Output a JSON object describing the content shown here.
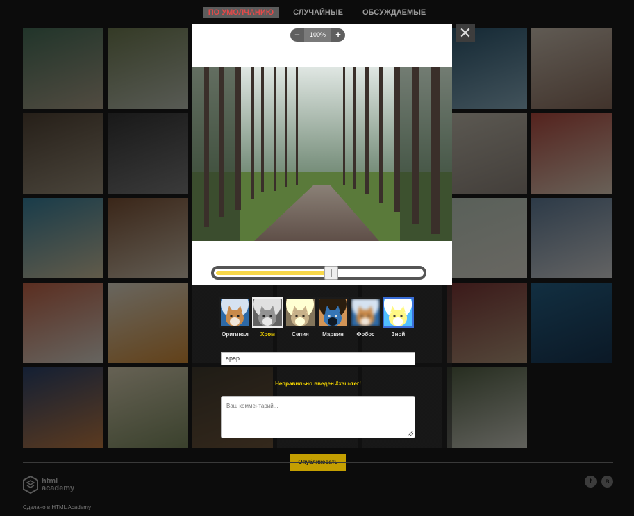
{
  "filters": [
    {
      "label": "По умолчанию",
      "active": true
    },
    {
      "label": "Случайные",
      "active": false
    },
    {
      "label": "Обсуждаемые",
      "active": false
    }
  ],
  "gallery": {
    "thumbs": [
      {
        "name": "thumb-coast-pool",
        "colors": [
          "#3f6d54",
          "#b1a38a"
        ]
      },
      {
        "name": "thumb-sign-field",
        "colors": [
          "#6c7a4a",
          "#c1c7b8"
        ]
      },
      {
        "name": "thumb-hidden-1",
        "colors": [
          "#333",
          "#333"
        ]
      },
      {
        "name": "thumb-hidden-2",
        "colors": [
          "#333",
          "#333"
        ]
      },
      {
        "name": "thumb-hidden-3",
        "colors": [
          "#333",
          "#333"
        ]
      },
      {
        "name": "thumb-sea-rocks",
        "colors": [
          "#1f4f6b",
          "#8cb4c8"
        ]
      },
      {
        "name": "thumb-woman-camera",
        "colors": [
          "#d4c7b6",
          "#8b6a58"
        ]
      },
      {
        "name": "thumb-snowmen-soup",
        "colors": [
          "#4a3a2a",
          "#a0937c"
        ]
      },
      {
        "name": "thumb-black-car",
        "colors": [
          "#2a2a2a",
          "#7a7a7a"
        ]
      },
      {
        "name": "thumb-hidden-4",
        "colors": [
          "#333",
          "#333"
        ]
      },
      {
        "name": "thumb-hidden-5",
        "colors": [
          "#333",
          "#333"
        ]
      },
      {
        "name": "thumb-hidden-6",
        "colors": [
          "#333",
          "#333"
        ]
      },
      {
        "name": "thumb-cake-plate",
        "colors": [
          "#c9c2b2",
          "#8f847a"
        ]
      },
      {
        "name": "thumb-red-drink",
        "colors": [
          "#b84236",
          "#e9d6c0"
        ]
      },
      {
        "name": "thumb-beach-jump",
        "colors": [
          "#2b7ea0",
          "#d8c8a0"
        ]
      },
      {
        "name": "thumb-wooden-box",
        "colors": [
          "#7a4a2a",
          "#d9cbb4"
        ]
      },
      {
        "name": "thumb-hidden-7",
        "colors": [
          "#333",
          "#333"
        ]
      },
      {
        "name": "thumb-hidden-8",
        "colors": [
          "#333",
          "#333"
        ]
      },
      {
        "name": "thumb-hidden-9",
        "colors": [
          "#333",
          "#333"
        ]
      },
      {
        "name": "thumb-dune",
        "colors": [
          "#c4d4c4",
          "#e8e4d8"
        ]
      },
      {
        "name": "thumb-white-car",
        "colors": [
          "#5a7a9a",
          "#dcdcdc"
        ]
      },
      {
        "name": "thumb-salmon-salad",
        "colors": [
          "#c75c3c",
          "#e3e0d4"
        ]
      },
      {
        "name": "thumb-sushi-cat",
        "colors": [
          "#e9e3d2",
          "#d98a2a"
        ]
      },
      {
        "name": "thumb-hidden-10",
        "colors": [
          "#333",
          "#333"
        ]
      },
      {
        "name": "thumb-hidden-11",
        "colors": [
          "#333",
          "#333"
        ]
      },
      {
        "name": "thumb-hidden-12",
        "colors": [
          "#333",
          "#333"
        ]
      },
      {
        "name": "thumb-red-car-hall",
        "colors": [
          "#7a2a2a",
          "#b89a7a"
        ]
      },
      {
        "name": "thumb-blue-lights",
        "colors": [
          "#1a5f8a",
          "#0a2a4a"
        ]
      },
      {
        "name": "thumb-palms-night",
        "colors": [
          "#1e3a6a",
          "#c97a3a"
        ]
      },
      {
        "name": "thumb-salad-bowl",
        "colors": [
          "#e3d8b8",
          "#7a8a5a"
        ]
      },
      {
        "name": "thumb-sunset-sea",
        "colors": [
          "#5a4a2a",
          "#c98a4a"
        ]
      },
      {
        "name": "thumb-hidden-13",
        "colors": [
          "#333",
          "#333"
        ]
      },
      {
        "name": "thumb-hidden-14",
        "colors": [
          "#333",
          "#333"
        ]
      },
      {
        "name": "thumb-jeep-water",
        "colors": [
          "#4a5a3a",
          "#d8d8cc"
        ]
      },
      {
        "name": "thumb-empty",
        "colors": [
          "#0c0c0c",
          "#0c0c0c"
        ]
      }
    ]
  },
  "upload": {
    "zoom": {
      "minus": "–",
      "value": "100%",
      "plus": "+"
    },
    "effect_level": 0.57,
    "close": "✕",
    "effects": [
      {
        "label": "Оригинал",
        "tint": "none",
        "selected": false
      },
      {
        "label": "Хром",
        "tint": "grayscale(1)",
        "selected": true
      },
      {
        "label": "Сепия",
        "tint": "sepia(1)",
        "selected": false
      },
      {
        "label": "Марвин",
        "tint": "invert(1)",
        "selected": false
      },
      {
        "label": "Фобос",
        "tint": "blur(2px)",
        "selected": false
      },
      {
        "label": "Зной",
        "tint": "brightness(1.8)",
        "selected": false
      }
    ],
    "hashtags": "арар",
    "error": "Неправильно введен #хэш-тег!",
    "comment_placeholder": "Ваш комментарий...",
    "submit": "Опубликовать"
  },
  "footer": {
    "logo_line1": "html",
    "logo_line2": "academy",
    "made_prefix": "Сделано в",
    "made_link": "HTML Academy",
    "social": [
      {
        "icon": "twitter-icon",
        "glyph": "t"
      },
      {
        "icon": "vk-icon",
        "glyph": "в"
      }
    ]
  },
  "colors": {
    "accent": "#f5d600",
    "active_filter": "#e34a4a",
    "bg": "#0c0c0c"
  }
}
